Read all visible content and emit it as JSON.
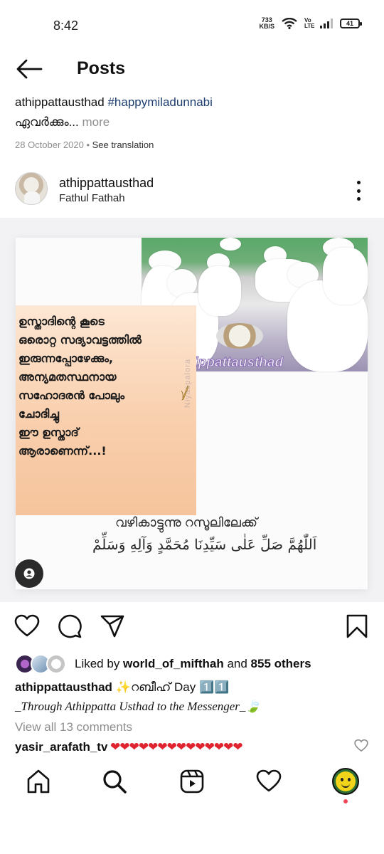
{
  "status_bar": {
    "time": "8:42",
    "net_speed_value": "733",
    "net_speed_unit": "KB/S",
    "volte_label": "Vo LTE",
    "battery": "41"
  },
  "top_bar": {
    "title": "Posts",
    "back_icon": "arrow-left-icon"
  },
  "caption_preview": {
    "username": "athippattausthad",
    "hashtag": "#happymiladunnabi",
    "text": "ഏവർക്കും...",
    "more": " more",
    "date": "28 October 2020",
    "separator": " • ",
    "see_translation": "See translation"
  },
  "post_header": {
    "username": "athippattausthad",
    "location": "Fathul Fathah",
    "more_icon": "more-vertical-icon"
  },
  "post_image": {
    "quote_text": "ഉസ്താദിന്റെ കൂടെ\nഒരൊറ്റ സദ്യാവട്ടത്തിൽ\nഇരുന്നപ്പോഴേക്കും,\nഅന്യമതസ്ഥനായ\nസഹോദരൻ പോലും\nചോദിച്ചു\nഈ ഉസ്താദ്\nആരാണെന്ന്...!",
    "insta_handle": "athippattausthad",
    "watermark": "Niyaspalora",
    "bottom_malayalam": "വഴികാട്ടുന്നു റസൂലിലേക്ക്",
    "bottom_arabic": "اَللّٰهُمَّ صَلِّ عَلٰى سَيِّدِنَا مُحَمَّدٍ وَآلِهِ وَسَلِّمْ",
    "user_tag_icon": "user-tag-icon"
  },
  "actions": {
    "like_icon": "heart-icon",
    "comment_icon": "comment-icon",
    "share_icon": "send-icon",
    "save_icon": "bookmark-icon"
  },
  "likes": {
    "prefix": "Liked by ",
    "user": "world_of_mifthah",
    "middle": " and ",
    "others": "855 others"
  },
  "caption_full": {
    "username": "athippattausthad",
    "text": " ✨റബീഹ് Day 1️⃣1️⃣",
    "line2": "_Through Athippatta Usthad to the Messenger_🍃"
  },
  "comments": {
    "view_all": "View all 13 comments",
    "top_comment_user": "yasir_arafath_tv",
    "top_comment_text": " ❤❤❤❤❤❤❤❤❤❤❤❤❤❤",
    "like_icon": "heart-outline-icon"
  },
  "bottom_nav": {
    "items": [
      "home-icon",
      "search-icon",
      "reels-icon",
      "activity-heart-icon",
      "profile-avatar"
    ]
  },
  "colors": {
    "hashtag": "#1c3d6e",
    "notification_dot": "#ed4956",
    "quote_bg": "#f9cfad",
    "heart_red": "#e0242f"
  }
}
